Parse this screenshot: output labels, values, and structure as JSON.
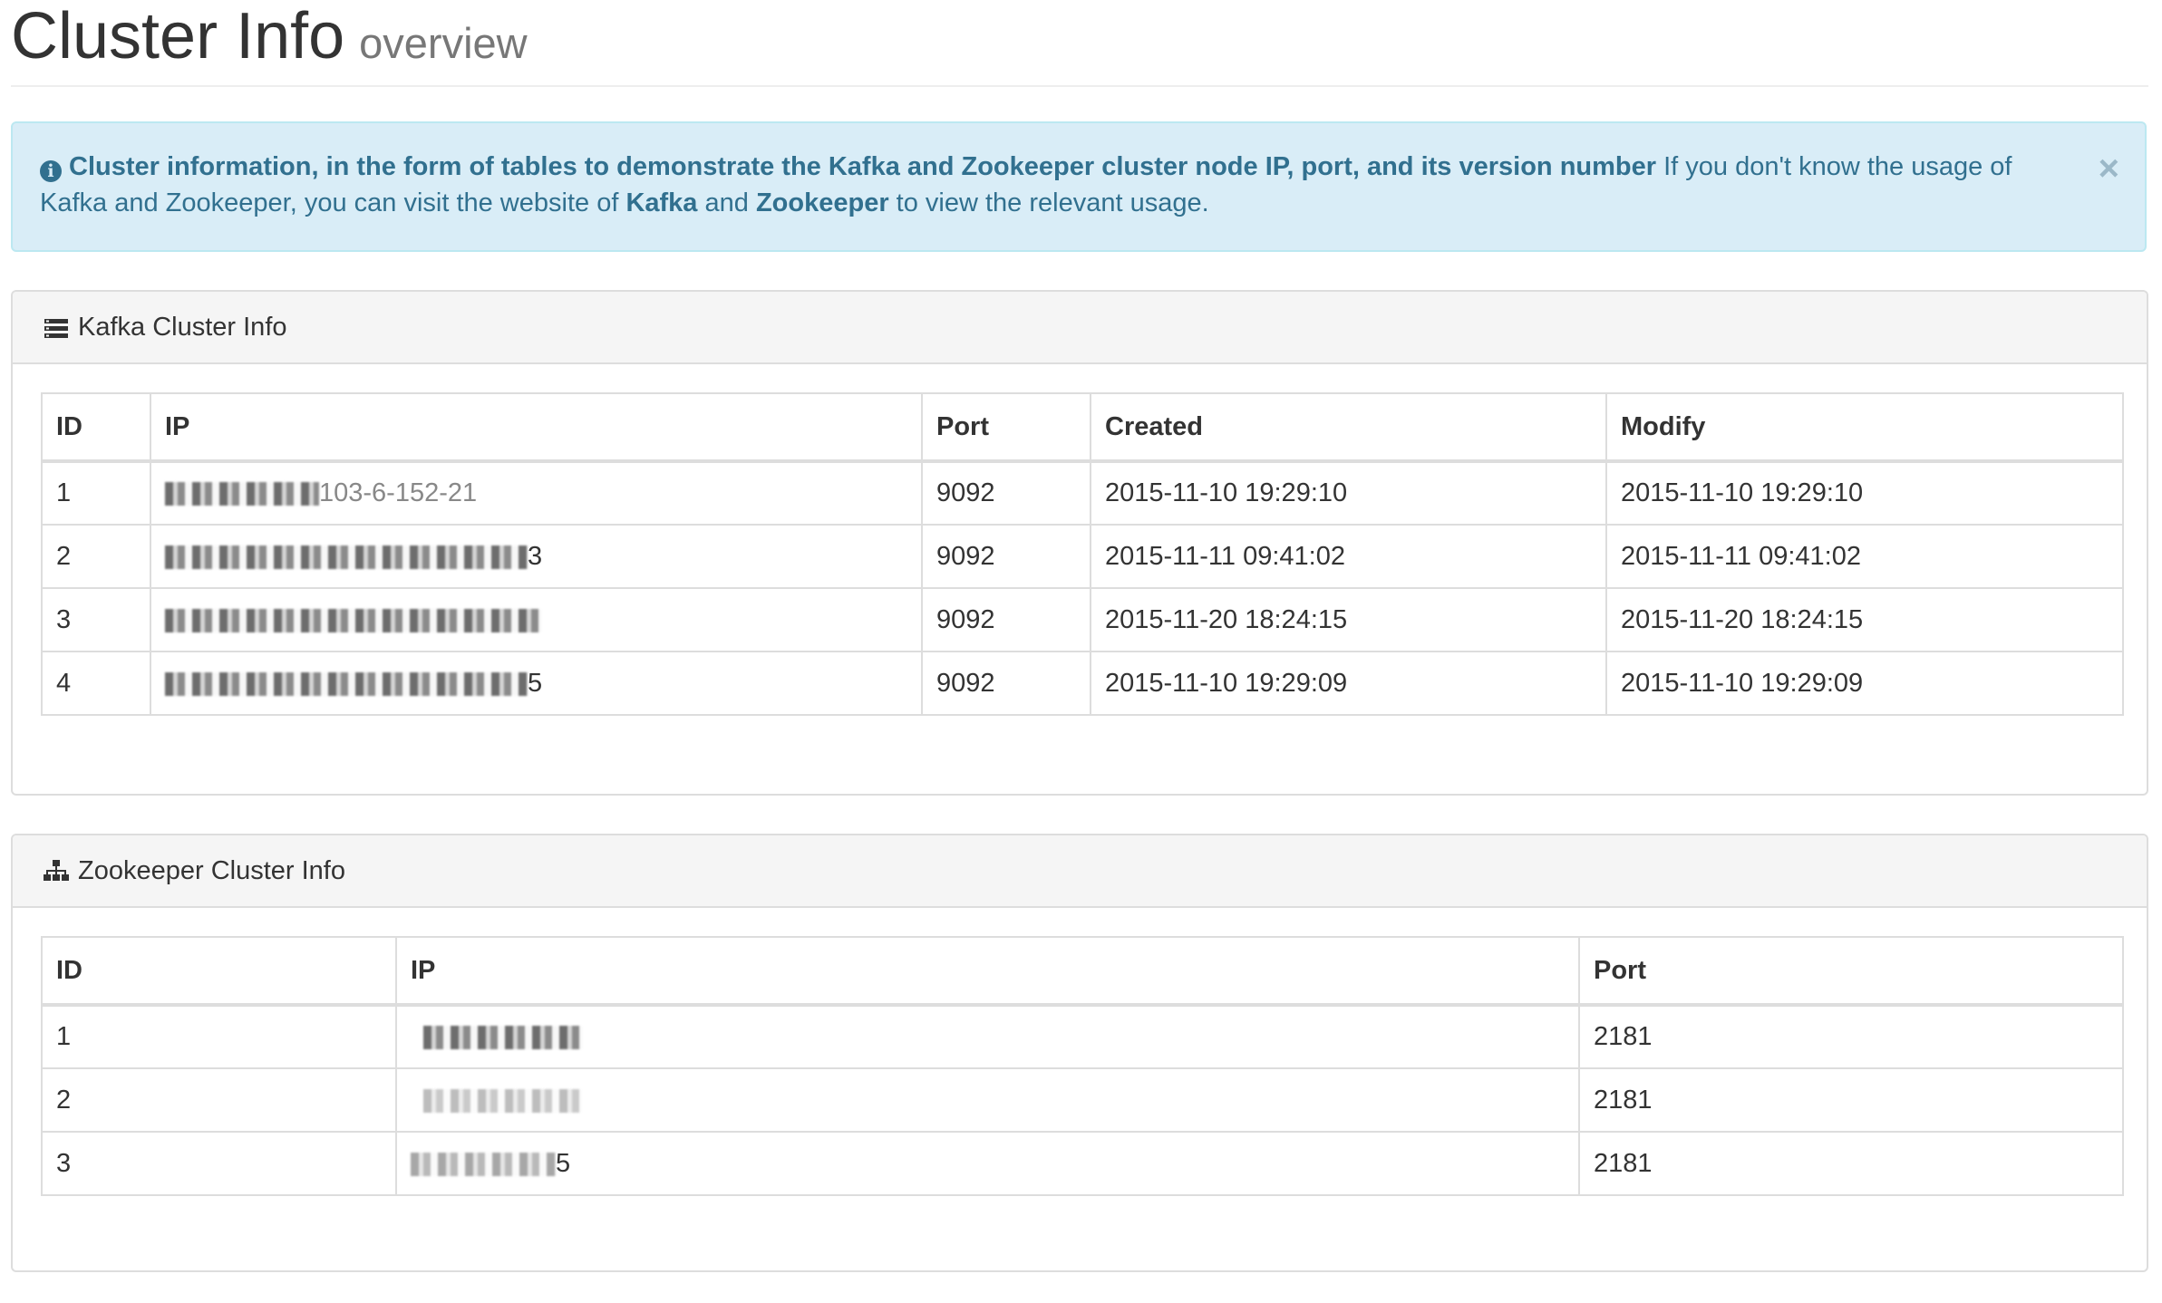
{
  "header": {
    "title": "Cluster Info",
    "subtitle": "overview"
  },
  "alert": {
    "icon": "info-circle-icon",
    "bold_text": "Cluster information, in the form of tables to demonstrate the Kafka and Zookeeper cluster node IP, port, and its version number",
    "text_1": " If you don't know the usage of Kafka and Zookeeper, you can visit the website of ",
    "kafka_link": "Kafka",
    "text_2": " and ",
    "zookeeper_link": "Zookeeper",
    "text_3": " to view the relevant usage.",
    "close": "×"
  },
  "kafka": {
    "icon": "server-stack-icon",
    "title": "Kafka Cluster Info",
    "columns": [
      "ID",
      "IP",
      "Port",
      "Created",
      "Modify"
    ],
    "rows": [
      {
        "id": "1",
        "ip_partial": "103-6-152-21",
        "port": "9092",
        "created": "2015-11-10 19:29:10",
        "modify": "2015-11-10 19:29:10"
      },
      {
        "id": "2",
        "ip_partial": "3",
        "port": "9092",
        "created": "2015-11-11 09:41:02",
        "modify": "2015-11-11 09:41:02"
      },
      {
        "id": "3",
        "ip_partial": "",
        "port": "9092",
        "created": "2015-11-20 18:24:15",
        "modify": "2015-11-20 18:24:15"
      },
      {
        "id": "4",
        "ip_partial": "5",
        "port": "9092",
        "created": "2015-11-10 19:29:09",
        "modify": "2015-11-10 19:29:09"
      }
    ]
  },
  "zookeeper": {
    "icon": "sitemap-icon",
    "title": "Zookeeper Cluster Info",
    "columns": [
      "ID",
      "IP",
      "Port"
    ],
    "rows": [
      {
        "id": "1",
        "ip_partial": "",
        "port": "2181"
      },
      {
        "id": "2",
        "ip_partial": "",
        "port": "2181"
      },
      {
        "id": "3",
        "ip_partial": "5",
        "port": "2181"
      }
    ]
  }
}
